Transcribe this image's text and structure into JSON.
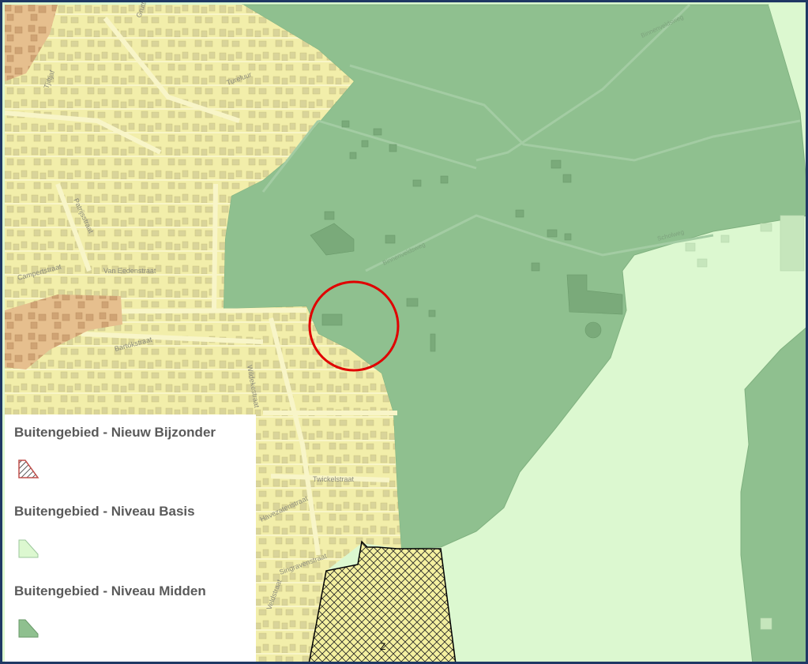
{
  "colors": {
    "residential": "#f2eeaa",
    "residential_street": "#e9e39a",
    "orange_zone": "#e5bf8c",
    "niveau_midden": "#8fc08f",
    "niveau_midden_dark": "#86b886",
    "niveau_basis": "#dcf8d0",
    "nieuw_bijzonder_stroke": "#c0504d",
    "highlight_circle": "#e00000",
    "border": "#1f3864"
  },
  "map": {
    "streets": [
      {
        "name": "Tjiftjaf"
      },
      {
        "name": "Grutto"
      },
      {
        "name": "Tureluur"
      },
      {
        "name": "Patrijsstraat"
      },
      {
        "name": "Campertstraat"
      },
      {
        "name": "Van Eedenstraat"
      },
      {
        "name": "Bartókstraat"
      },
      {
        "name": "Wildekestraat"
      },
      {
        "name": "Twickelstraat"
      },
      {
        "name": "Havezatenstraat"
      },
      {
        "name": "Singravenstraat"
      },
      {
        "name": "Veldstraat"
      },
      {
        "name": "Binnenveldsweg"
      },
      {
        "name": "Scholweg"
      }
    ],
    "hatched_area_label": "Z",
    "highlight": {
      "shape": "circle",
      "color": "red"
    }
  },
  "legend": {
    "items": [
      {
        "label": "Buitengebied - Nieuw Bijzonder",
        "icon": "hatched-red-triangle-icon"
      },
      {
        "label": "Buitengebied - Niveau Basis",
        "icon": "light-green-polygon-icon"
      },
      {
        "label": "Buitengebied - Niveau Midden",
        "icon": "dark-green-polygon-icon"
      }
    ]
  }
}
